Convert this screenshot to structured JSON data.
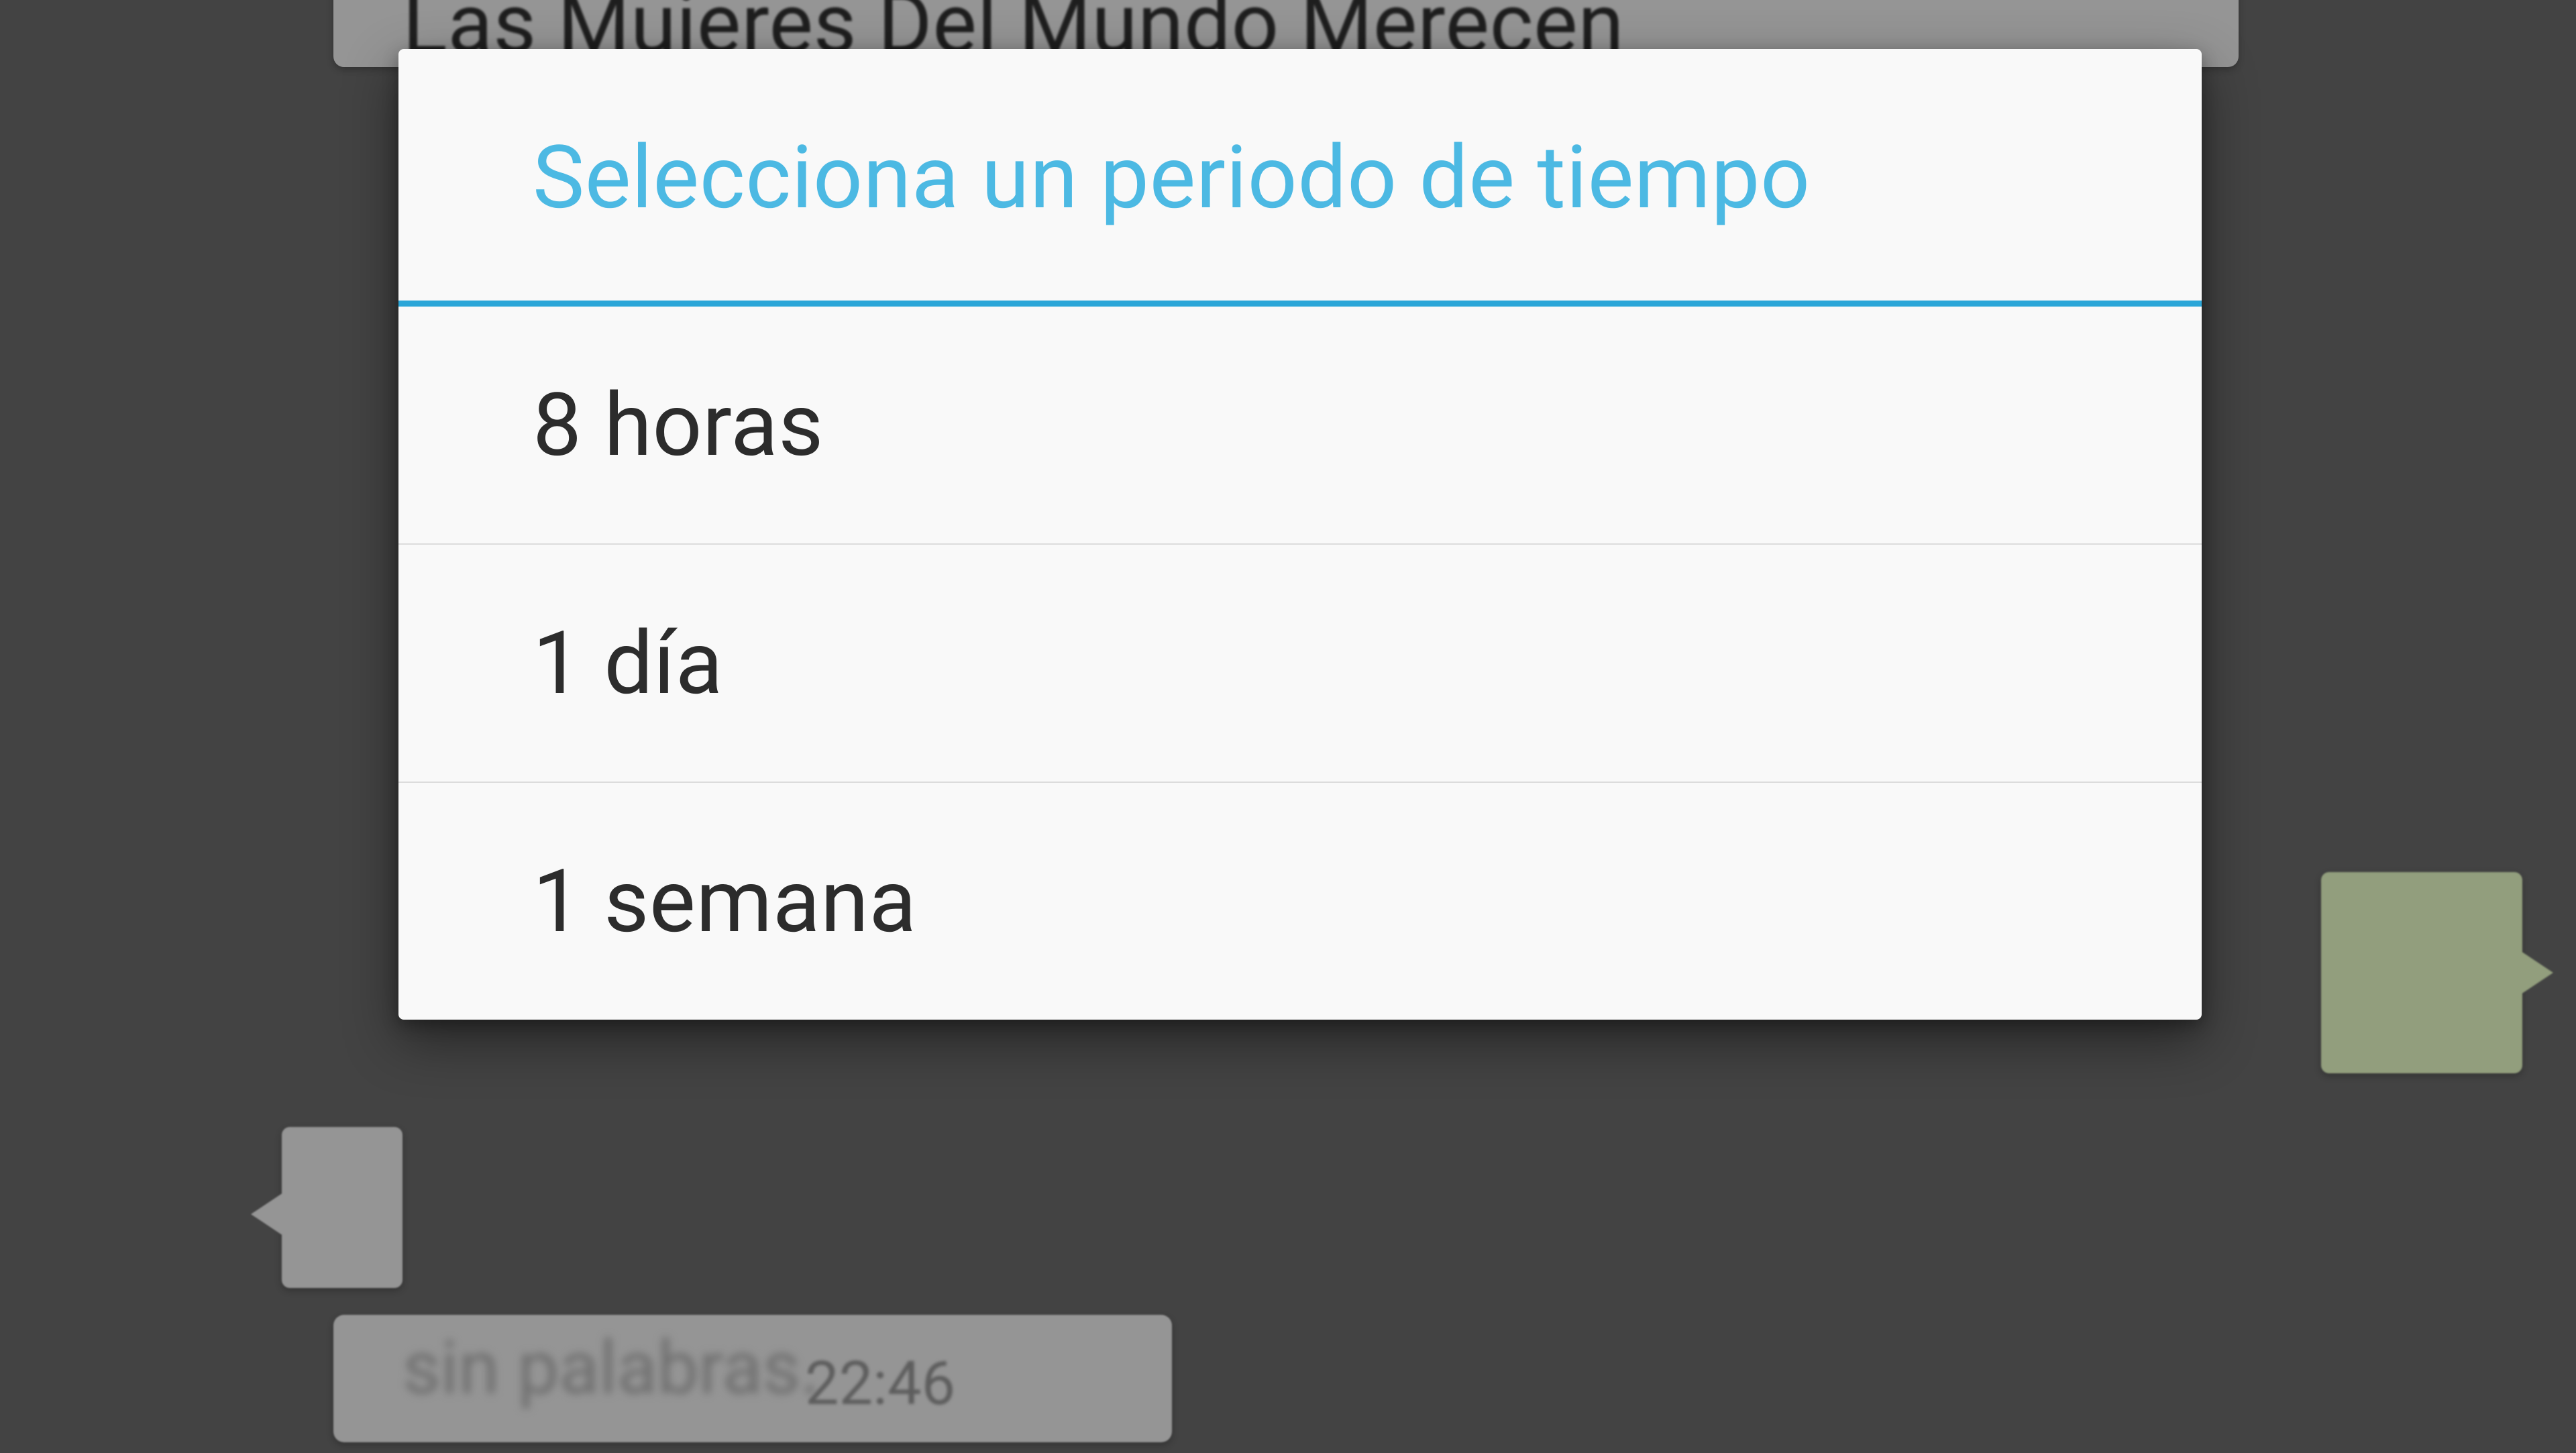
{
  "colors": {
    "accent": "#2ba6d8",
    "title_text": "#4cb9e3",
    "dialog_bg": "#f9f9f9",
    "backdrop": "#636363"
  },
  "background": {
    "top_message_text": "Las Mujeres Del Mundo Merecen",
    "bottom_message_text": "sin palabras.",
    "bottom_time": "22:46"
  },
  "dialog": {
    "title": "Selecciona un periodo de tiempo",
    "options": [
      {
        "label": "8 horas"
      },
      {
        "label": "1 día"
      },
      {
        "label": "1 semana"
      }
    ]
  }
}
